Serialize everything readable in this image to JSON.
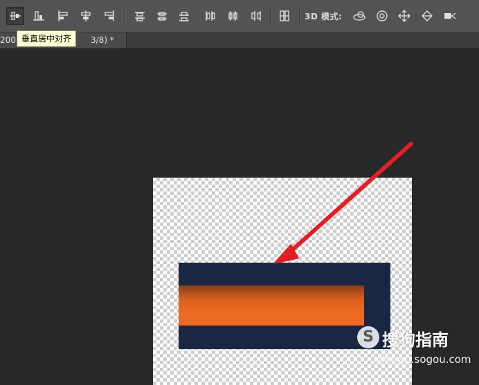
{
  "toolbar": {
    "mode_label": "3D 模式:",
    "align_buttons": [
      {
        "name": "align-top-edges-icon",
        "active": true
      },
      {
        "name": "align-vertical-centers-icon",
        "active": false
      },
      {
        "name": "align-bottom-edges-icon",
        "active": false
      },
      {
        "name": "align-left-edges-icon",
        "active": false
      },
      {
        "name": "align-horizontal-centers-icon",
        "active": false
      },
      {
        "name": "align-right-edges-icon",
        "active": false
      }
    ],
    "distribute_buttons": [
      "distribute-top-edges-icon",
      "distribute-vertical-centers-icon",
      "distribute-bottom-edges-icon",
      "distribute-left-edges-icon",
      "distribute-horizontal-centers-icon",
      "distribute-right-edges-icon"
    ],
    "auto_align_icon": "auto-align-layers-icon",
    "mode_3d_icons": [
      "3d-orbit-icon",
      "3d-roll-icon",
      "3d-pan-icon",
      "3d-slide-icon",
      "3d-scale-icon"
    ]
  },
  "tooltip": {
    "text": "垂直居中对齐"
  },
  "document_tab": {
    "title": "200",
    "suffix": "3/8) *"
  },
  "colors": {
    "navy": "#1a2743",
    "orange": "#ec6a22",
    "arrow": "#e01f26",
    "tooltip_bg": "#ffffd6"
  },
  "watermark": {
    "logo_letter": "S",
    "name": "搜狗指南",
    "url": "zhinan.sogou.com"
  }
}
